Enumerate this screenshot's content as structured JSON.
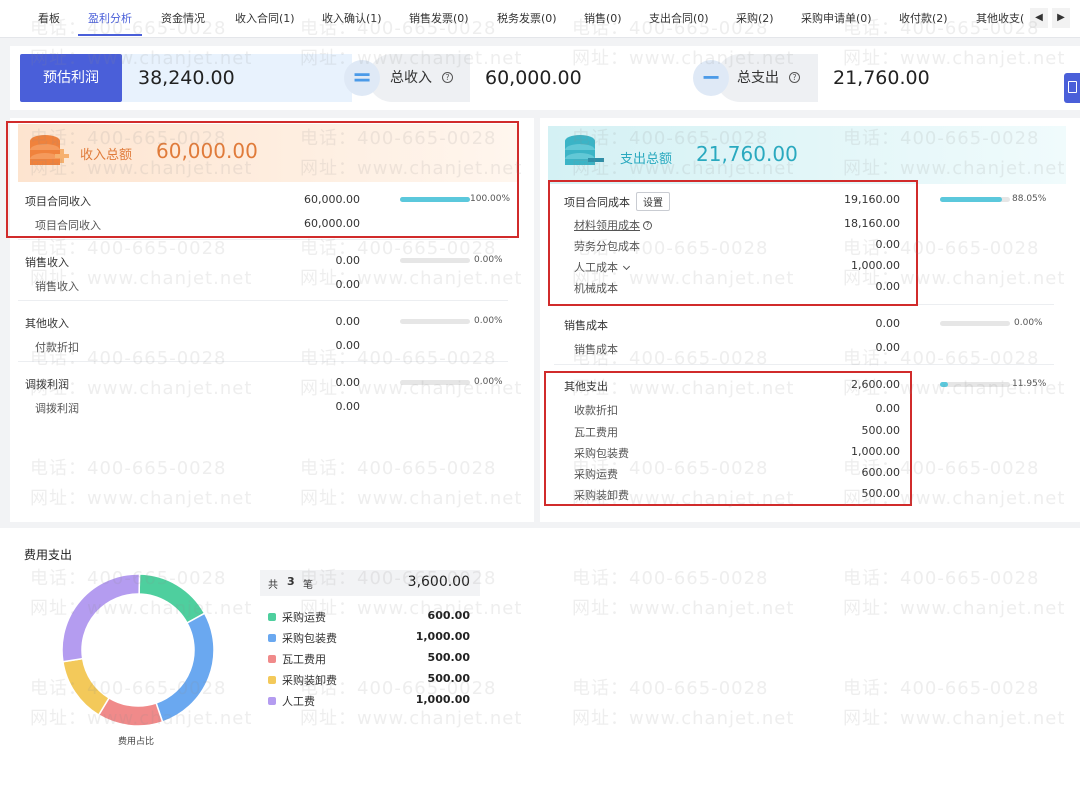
{
  "tabs": [
    {
      "label": "看板",
      "active": false
    },
    {
      "label": "盈利分析",
      "active": true
    },
    {
      "label": "资金情况",
      "active": false
    },
    {
      "label": "收入合同(1)",
      "active": false
    },
    {
      "label": "收入确认(1)",
      "active": false
    },
    {
      "label": "销售发票(0)",
      "active": false
    },
    {
      "label": "税务发票(0)",
      "active": false
    },
    {
      "label": "销售(0)",
      "active": false
    },
    {
      "label": "支出合同(0)",
      "active": false
    },
    {
      "label": "采购(2)",
      "active": false
    },
    {
      "label": "采购申请单(0)",
      "active": false
    },
    {
      "label": "收付款(2)",
      "active": false
    },
    {
      "label": "其他收支(",
      "active": false
    }
  ],
  "tab_nav": {
    "prev": "◀",
    "next": "▶"
  },
  "summary": {
    "profit_label": "预估利润",
    "profit_value": "38,240.00",
    "equals": "=",
    "income_label": "总收入",
    "income_value": "60,000.00",
    "minus": "−",
    "expense_label": "总支出",
    "expense_value": "21,760.00",
    "help": "?"
  },
  "income": {
    "title": "收入总额",
    "total": "60,000.00",
    "groups": [
      {
        "name": "项目合同收入",
        "value": "60,000.00",
        "percent": "100.00%",
        "ratio": 1.0,
        "items": [
          {
            "name": "项目合同收入",
            "value": "60,000.00"
          }
        ]
      },
      {
        "name": "销售收入",
        "value": "0.00",
        "percent": "0.00%",
        "ratio": 0,
        "items": [
          {
            "name": "销售收入",
            "value": "0.00"
          }
        ]
      },
      {
        "name": "其他收入",
        "value": "0.00",
        "percent": "0.00%",
        "ratio": 0,
        "items": [
          {
            "name": "付款折扣",
            "value": "0.00"
          }
        ]
      },
      {
        "name": "调拨利润",
        "value": "0.00",
        "percent": "0.00%",
        "ratio": 0,
        "items": [
          {
            "name": "调拨利润",
            "value": "0.00"
          }
        ]
      }
    ]
  },
  "expense": {
    "title": "支出总额",
    "total": "21,760.00",
    "settings_label": "设置",
    "groups": [
      {
        "name": "项目合同成本",
        "value": "19,160.00",
        "percent": "88.05%",
        "ratio": 0.8805,
        "items": [
          {
            "name": "材料领用成本",
            "value": "18,160.00"
          },
          {
            "name": "劳务分包成本",
            "value": "0.00"
          },
          {
            "name": "人工成本",
            "value": "1,000.00"
          },
          {
            "name": "机械成本",
            "value": "0.00"
          }
        ]
      },
      {
        "name": "销售成本",
        "value": "0.00",
        "percent": "0.00%",
        "ratio": 0,
        "items": [
          {
            "name": "销售成本",
            "value": "0.00"
          }
        ]
      },
      {
        "name": "其他支出",
        "value": "2,600.00",
        "percent": "11.95%",
        "ratio": 0.1195,
        "items": [
          {
            "name": "收款折扣",
            "value": "0.00"
          },
          {
            "name": "瓦工费用",
            "value": "500.00"
          },
          {
            "name": "采购包装费",
            "value": "1,000.00"
          },
          {
            "name": "采购运费",
            "value": "600.00"
          },
          {
            "name": "采购装卸费",
            "value": "500.00"
          }
        ]
      }
    ]
  },
  "fees": {
    "title": "费用支出",
    "count_prefix": "共",
    "count": "3",
    "count_suffix": "笔",
    "total": "3,600.00",
    "chart_caption": "费用占比",
    "legend": [
      {
        "name": "采购运费",
        "value": "600.00",
        "amount": 600,
        "color": "#4ecf9e"
      },
      {
        "name": "采购包装费",
        "value": "1,000.00",
        "amount": 1000,
        "color": "#6aa8f0"
      },
      {
        "name": "瓦工费用",
        "value": "500.00",
        "amount": 500,
        "color": "#f08a8a"
      },
      {
        "name": "采购装卸费",
        "value": "500.00",
        "amount": 500,
        "color": "#f3c95a"
      },
      {
        "name": "人工费",
        "value": "1,000.00",
        "amount": 1000,
        "color": "#b49cf0"
      }
    ]
  },
  "watermark": {
    "phone": "电话：400-665-0028",
    "site": "网址：www.chanjet.net"
  }
}
